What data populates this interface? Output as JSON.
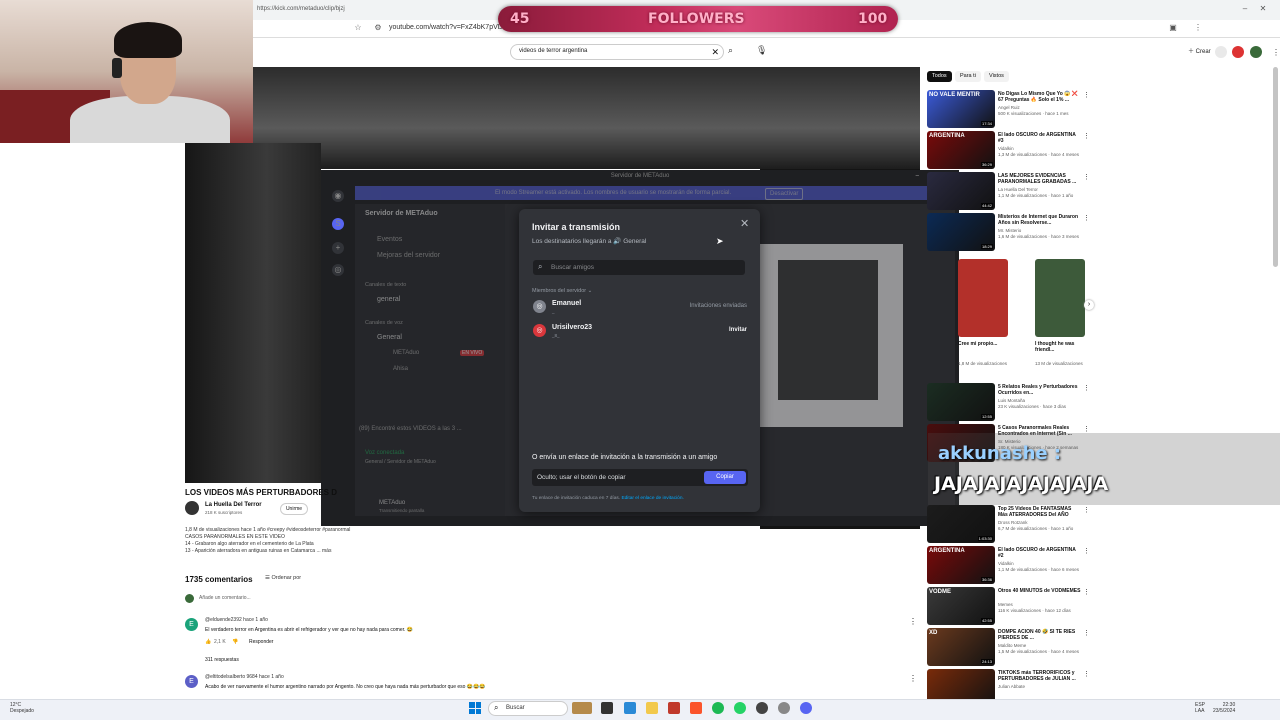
{
  "browser": {
    "tab_title": "https://kick.com/metaduo/clip/bjzj",
    "url": "youtube.com/watch?v=FxZ4bK7pVDU"
  },
  "overlay": {
    "followers_current": "45",
    "followers_label": "FOLLOWERS",
    "followers_goal": "100",
    "chat_user": "akkunashe :",
    "chat_message": "JAJAJAJAJAJAJAJA"
  },
  "youtube": {
    "search_value": "videos de terror argentina",
    "create_label": "Crear",
    "video_title": "LOS VIDEOS MÁS PERTURBADORES D",
    "channel_name": "La Huella Del Terror",
    "channel_subs": "218 K suscriptores",
    "join_label": "Unirme",
    "description": [
      "1,8 M de visualizaciones  hace 1 año  #creepy #videosdeterror #paranormal",
      "CASOS PARANORMALES EN ESTE VIDEO",
      "14 - Grabaron algo aterrador en el cementerio de La Plata",
      "13 - Aparición aterradora en antiguas ruinas en Catamarca ... más"
    ],
    "comments_count": "1735 comentarios",
    "sort_label": "Ordenar por",
    "add_comment": "Añade un comentario...",
    "comments": [
      {
        "initial": "E",
        "author": "@elduende2392  hace 1 año",
        "text": "El verdadero terror en Argentina es abrir el refrigerador y ver que no hay nada para comer. 😂",
        "likes": "2,1 K",
        "reply_label": "Responder",
        "replies": "311 respuestas"
      },
      {
        "initial": "E",
        "author": "@eltitodelsalberto 9684  hace 1 año",
        "text": "Acabo de ver nuevamente el humor argentino narrado por Angento. No creo que haya nada más perturbador que eso 😂😂😂"
      }
    ],
    "chips": [
      "Todos",
      "Para ti",
      "Vistos"
    ],
    "recommendations": [
      {
        "title": "No Digas Lo Mismo Que Yo 😱 ❌ 67 Preguntas 🔥 Solo el 1% ...",
        "channel": "Angel Ruiz",
        "views": "500 K visualizaciones · hace 1 mes",
        "duration": "17:34",
        "overlay": "NO VALE MENTIR",
        "color": "#3b5bd9"
      },
      {
        "title": "El lado OSCURO de ARGENTINA #3",
        "channel": "Vidalkin",
        "views": "1,3 M de visualizaciones · hace 4 meses",
        "duration": "36:29",
        "overlay": "ARGENTINA",
        "color": "#7a0a0a"
      },
      {
        "title": "LAS MEJORES EVIDENCIAS PARANORMALES GRABADAS ...",
        "channel": "La Huella Del Terror",
        "views": "1,1 M de visualizaciones · hace 1 año",
        "duration": "44:42",
        "overlay": "",
        "color": "#2a2a40"
      },
      {
        "title": "Misterios de Internet que Duraron Años sin Resolverse...",
        "channel": "Mr. Misterio",
        "views": "1,6 M de visualizaciones · hace 3 meses",
        "duration": "18:29",
        "overlay": "",
        "color": "#0b2a55"
      },
      {
        "title": "5 Relatos Reales y Perturbadores Ocurridos en...",
        "channel": "Luis Montaña",
        "views": "23 K visualizaciones · hace 3 días",
        "duration": "12:55",
        "overlay": "",
        "color": "#1b2d22"
      },
      {
        "title": "5 Casos Paranormales Reales Encontrados en Internet (Sin ...",
        "channel": "Sr. Misterio",
        "views": "180 K visualizaciones · hace 2 semanas",
        "duration": "",
        "overlay": "",
        "color": "#4a0d0d"
      },
      {
        "title": "Top 25 Videos De FANTASMAS Más ATERRADORES Del AÑO",
        "channel": "Dross Rotzank",
        "views": "6,7 M de visualizaciones · hace 1 año",
        "duration": "1:03:30",
        "overlay": "",
        "color": "#1c1c1c"
      },
      {
        "title": "El lado OSCURO de ARGENTINA #2",
        "channel": "Vidalkin",
        "views": "1,1 M de visualizaciones · hace 6 meses",
        "duration": "36:36",
        "overlay": "ARGENTINA",
        "color": "#7a0a0a"
      },
      {
        "title": "Otros 40 MINUTOS de VODMEMES",
        "channel": "Memes",
        "views": "116 K visualizaciones · hace 12 días",
        "duration": "42:55",
        "overlay": "VODME",
        "color": "#3a3a3a"
      },
      {
        "title": "DOMPE ACION 40 🤣 SI TE RIES PIERDES DE ...",
        "channel": "Maldito Meme",
        "views": "1,5 M de visualizaciones · hace 4 meses",
        "duration": "24:13",
        "overlay": "XD",
        "color": "#6b3a1e"
      },
      {
        "title": "TIKTOKS más TERRORIFICOS y PERTURBADORES de JULIAN ...",
        "channel": "Julian Abbate",
        "views": "",
        "duration": "",
        "overlay": "",
        "color": "#7a2b0a"
      }
    ],
    "shorts": [
      {
        "title": "Cree mi propio...",
        "views": "1,8 M de visualizaciones",
        "color": "#b3302a"
      },
      {
        "title": "I thought he was friendl...",
        "views": "13 M de visualizaciones",
        "color": "#3d5a3a"
      }
    ]
  },
  "discord": {
    "window_title": "Servidor de METAduo",
    "streamer_banner": "El modo Streamer está activado. Los nombres de usuario se mostrarán de forma parcial.",
    "banner_button": "Desactivar",
    "server_name": "Servidor de METAduo",
    "channels": [
      "Eventos",
      "Mejoras del servidor",
      "Canales de texto",
      "general",
      "Canales de voz",
      "General",
      "METAduo",
      "Ahisa"
    ],
    "live_badge": "EN VIVO",
    "voice_status": "Voz conectada",
    "voice_sub": "General / Servidor de METAduo",
    "user_name": "METAduo",
    "user_status": "Transmitiendo pantalla",
    "thread_preview": "(89) Encontré estos VIDEOS a las 3 ...",
    "modal": {
      "title": "Invitar a transmisión",
      "subtitle": "Los destinatarios llegarán a 🔊 General",
      "search_placeholder": "Buscar amigos",
      "members_header": "Miembros del servidor ⌄",
      "members": [
        {
          "name": "Emanuel",
          "sub": "_",
          "action": "Invitaciones enviadas",
          "is_button": false
        },
        {
          "name": "Urisilvero23",
          "sub": "_8_",
          "action": "Invitar",
          "is_button": true
        }
      ],
      "link_label": "O envía un enlace de invitación a la transmisión a un amigo",
      "link_value": "Oculto; usar el botón de copiar",
      "copy_label": "Copiar",
      "link_note": "Tu enlace de invitación caduca en 7 días.",
      "link_edit": "Editar el enlace de invitación."
    }
  },
  "taskbar": {
    "weather_temp": "12°C",
    "weather_desc": "Despejado",
    "search_label": "Buscar",
    "lang": "ESP",
    "lang2": "LAA",
    "time": "22:30",
    "date": "23/5/2024"
  }
}
